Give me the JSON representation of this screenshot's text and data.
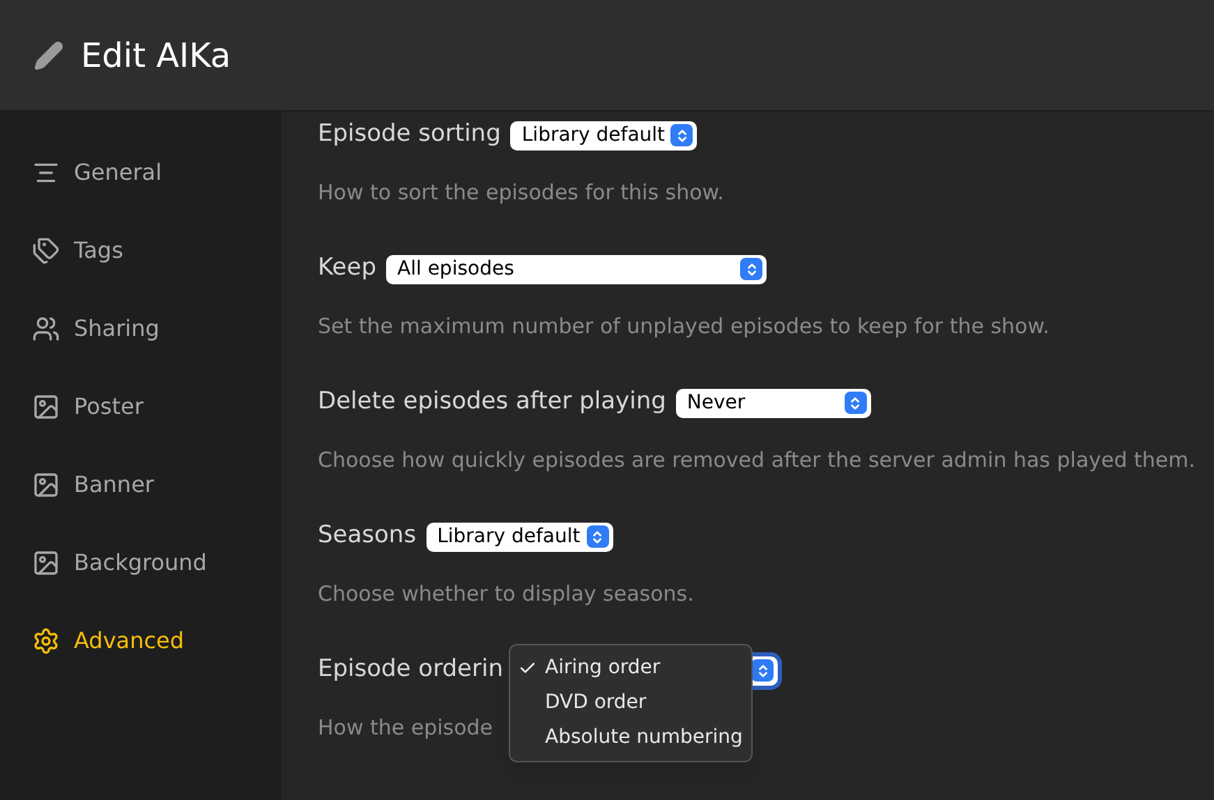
{
  "header": {
    "title": "Edit AIKa"
  },
  "sidebar": {
    "items": [
      {
        "label": "General",
        "selected": false
      },
      {
        "label": "Tags",
        "selected": false
      },
      {
        "label": "Sharing",
        "selected": false
      },
      {
        "label": "Poster",
        "selected": false
      },
      {
        "label": "Banner",
        "selected": false
      },
      {
        "label": "Background",
        "selected": false
      },
      {
        "label": "Advanced",
        "selected": true
      }
    ]
  },
  "settings": [
    {
      "label": "Episode sorting",
      "select": {
        "value": "Library default",
        "focused": false
      },
      "description": "How to sort the episodes for this show."
    },
    {
      "label": "Keep",
      "select": {
        "value": "All episodes",
        "focused": false
      },
      "description": "Set the maximum number of unplayed episodes to keep for the show."
    },
    {
      "label": "Delete episodes after playing",
      "select": {
        "value": "Never",
        "focused": false
      },
      "description": "Choose how quickly episodes are removed after the server admin has played them."
    },
    {
      "label": "Seasons",
      "select": {
        "value": "Library default",
        "focused": false
      },
      "description": "Choose whether to display seasons."
    },
    {
      "label": "Episode orderin",
      "select": {
        "focused": true,
        "menu": [
          {
            "label": "Airing order",
            "selected": true
          },
          {
            "label": "DVD order",
            "selected": false
          },
          {
            "label": "Absolute numbering",
            "selected": false
          }
        ]
      },
      "description": "How the episode"
    }
  ]
}
